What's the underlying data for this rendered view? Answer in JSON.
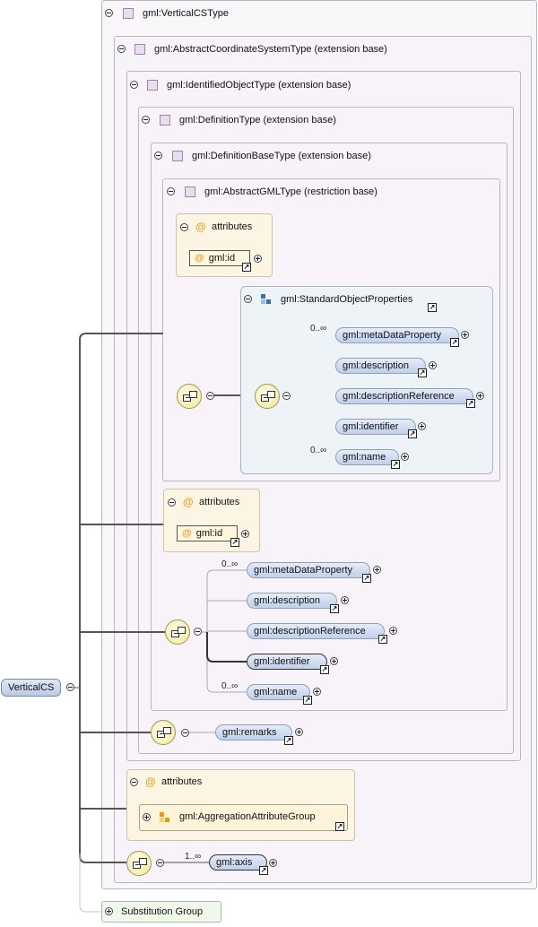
{
  "frames": {
    "vertical_cs_type": "gml:VerticalCSType",
    "abstract_cs_type": "gml:AbstractCoordinateSystemType (extension base)",
    "identified_object_type": "gml:IdentifiedObjectType (extension base)",
    "definition_type": "gml:DefinitionType (extension base)",
    "definition_base_type": "gml:DefinitionBaseType (extension base)",
    "abstract_gml_type": "gml:AbstractGMLType (restriction base)",
    "standard_object_properties": "gml:StandardObjectProperties"
  },
  "attributes_label": "attributes",
  "attribute_symbol": "@",
  "link_symbol": "↗",
  "inner": {
    "id_attr": "gml:id",
    "elements": [
      "gml:metaDataProperty",
      "gml:description",
      "gml:descriptionReference",
      "gml:identifier",
      "gml:name"
    ],
    "occ_first": "0..∞",
    "occ_last": "0..∞"
  },
  "mid": {
    "id_attr": "gml:id",
    "elements": [
      "gml:metaDataProperty",
      "gml:description",
      "gml:descriptionReference",
      "gml:identifier",
      "gml:name"
    ],
    "occ_first": "0..∞",
    "occ_last": "0..∞"
  },
  "remarks": "gml:remarks",
  "aggregation_group": "gml:AggregationAttributeGroup",
  "axis": "gml:axis",
  "axis_occ": "1..∞",
  "root": "VerticalCS",
  "substitution_group": "Substitution Group",
  "colors": {
    "type_frame": "#f8f3f8",
    "sop_frame": "#eef3f8",
    "attribute_frame": "#fdf5e4",
    "element_fill": "#c8d6ee",
    "sequence_fill": "#f1e89e",
    "substitution_fill": "#eef9ec"
  }
}
